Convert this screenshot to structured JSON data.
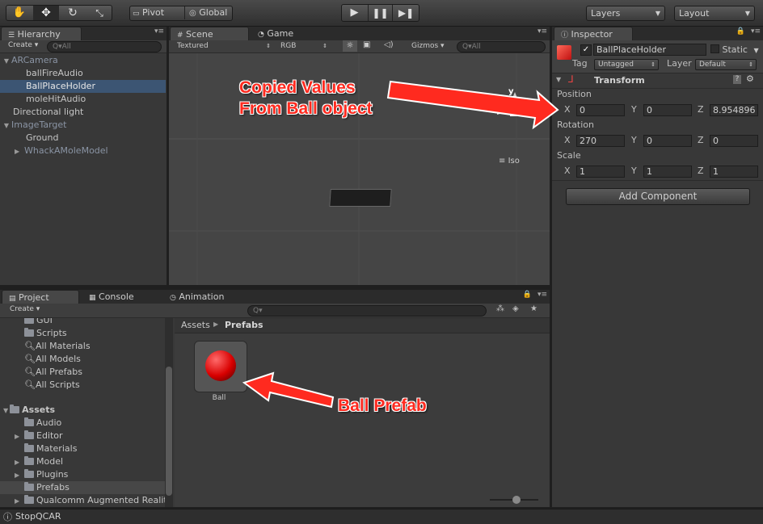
{
  "toolbar": {
    "pivot_label": "Pivot",
    "global_label": "Global",
    "layers_label": "Layers",
    "layout_label": "Layout"
  },
  "hierarchy": {
    "tab_label": "Hierarchy",
    "create_label": "Create",
    "search_placeholder": "Q▾All",
    "items": [
      {
        "label": "ARCamera"
      },
      {
        "label": "ballFireAudio"
      },
      {
        "label": "BallPlaceHolder"
      },
      {
        "label": "moleHitAudio"
      },
      {
        "label": "Directional light"
      },
      {
        "label": "ImageTarget"
      },
      {
        "label": "Ground"
      },
      {
        "label": "WhackAMoleModel"
      }
    ]
  },
  "scene": {
    "tab_scene": "Scene",
    "tab_game": "Game",
    "textured_label": "Textured",
    "rgb_label": "RGB",
    "gizmos_label": "Gizmos",
    "search_placeholder": "Q▾All",
    "axis_y": "y",
    "axis_z": "z",
    "iso_label": "Iso"
  },
  "inspector": {
    "tab_label": "Inspector",
    "object_name": "BallPlaceHolder",
    "static_label": "Static",
    "tag_label": "Tag",
    "tag_value": "Untagged",
    "layer_label": "Layer",
    "layer_value": "Default",
    "transform_label": "Transform",
    "position_label": "Position",
    "rotation_label": "Rotation",
    "scale_label": "Scale",
    "axis_x": "X",
    "axis_y": "Y",
    "axis_z": "Z",
    "position": {
      "x": "0",
      "y": "0",
      "z": "8.954896"
    },
    "rotation": {
      "x": "270",
      "y": "0",
      "z": "0"
    },
    "scale": {
      "x": "1",
      "y": "1",
      "z": "1"
    },
    "add_component_label": "Add Component"
  },
  "project": {
    "tab_project": "Project",
    "tab_console": "Console",
    "tab_animation": "Animation",
    "create_label": "Create",
    "tree": [
      {
        "label": "GUI",
        "kind": "folder"
      },
      {
        "label": "Scripts",
        "kind": "folder"
      },
      {
        "label": "All Materials",
        "kind": "search"
      },
      {
        "label": "All Models",
        "kind": "search"
      },
      {
        "label": "All Prefabs",
        "kind": "search"
      },
      {
        "label": "All Scripts",
        "kind": "search"
      },
      {
        "label": "Assets",
        "kind": "root"
      },
      {
        "label": "Audio",
        "kind": "folder"
      },
      {
        "label": "Editor",
        "kind": "folder"
      },
      {
        "label": "Materials",
        "kind": "folder"
      },
      {
        "label": "Model",
        "kind": "folder"
      },
      {
        "label": "Plugins",
        "kind": "folder"
      },
      {
        "label": "Prefabs",
        "kind": "folder"
      },
      {
        "label": "Qualcomm Augmented Reality",
        "kind": "folder"
      }
    ],
    "breadcrumb_root": "Assets",
    "breadcrumb_current": "Prefabs",
    "asset_name": "Ball"
  },
  "status": {
    "message": "StopQCAR"
  },
  "annotations": {
    "copied_line1": "Copied Values",
    "copied_line2": "From Ball object",
    "ball_prefab": "Ball Prefab"
  },
  "colors": {
    "accent_selection": "#3c5573",
    "annotation_red": "#ff2a1f"
  }
}
